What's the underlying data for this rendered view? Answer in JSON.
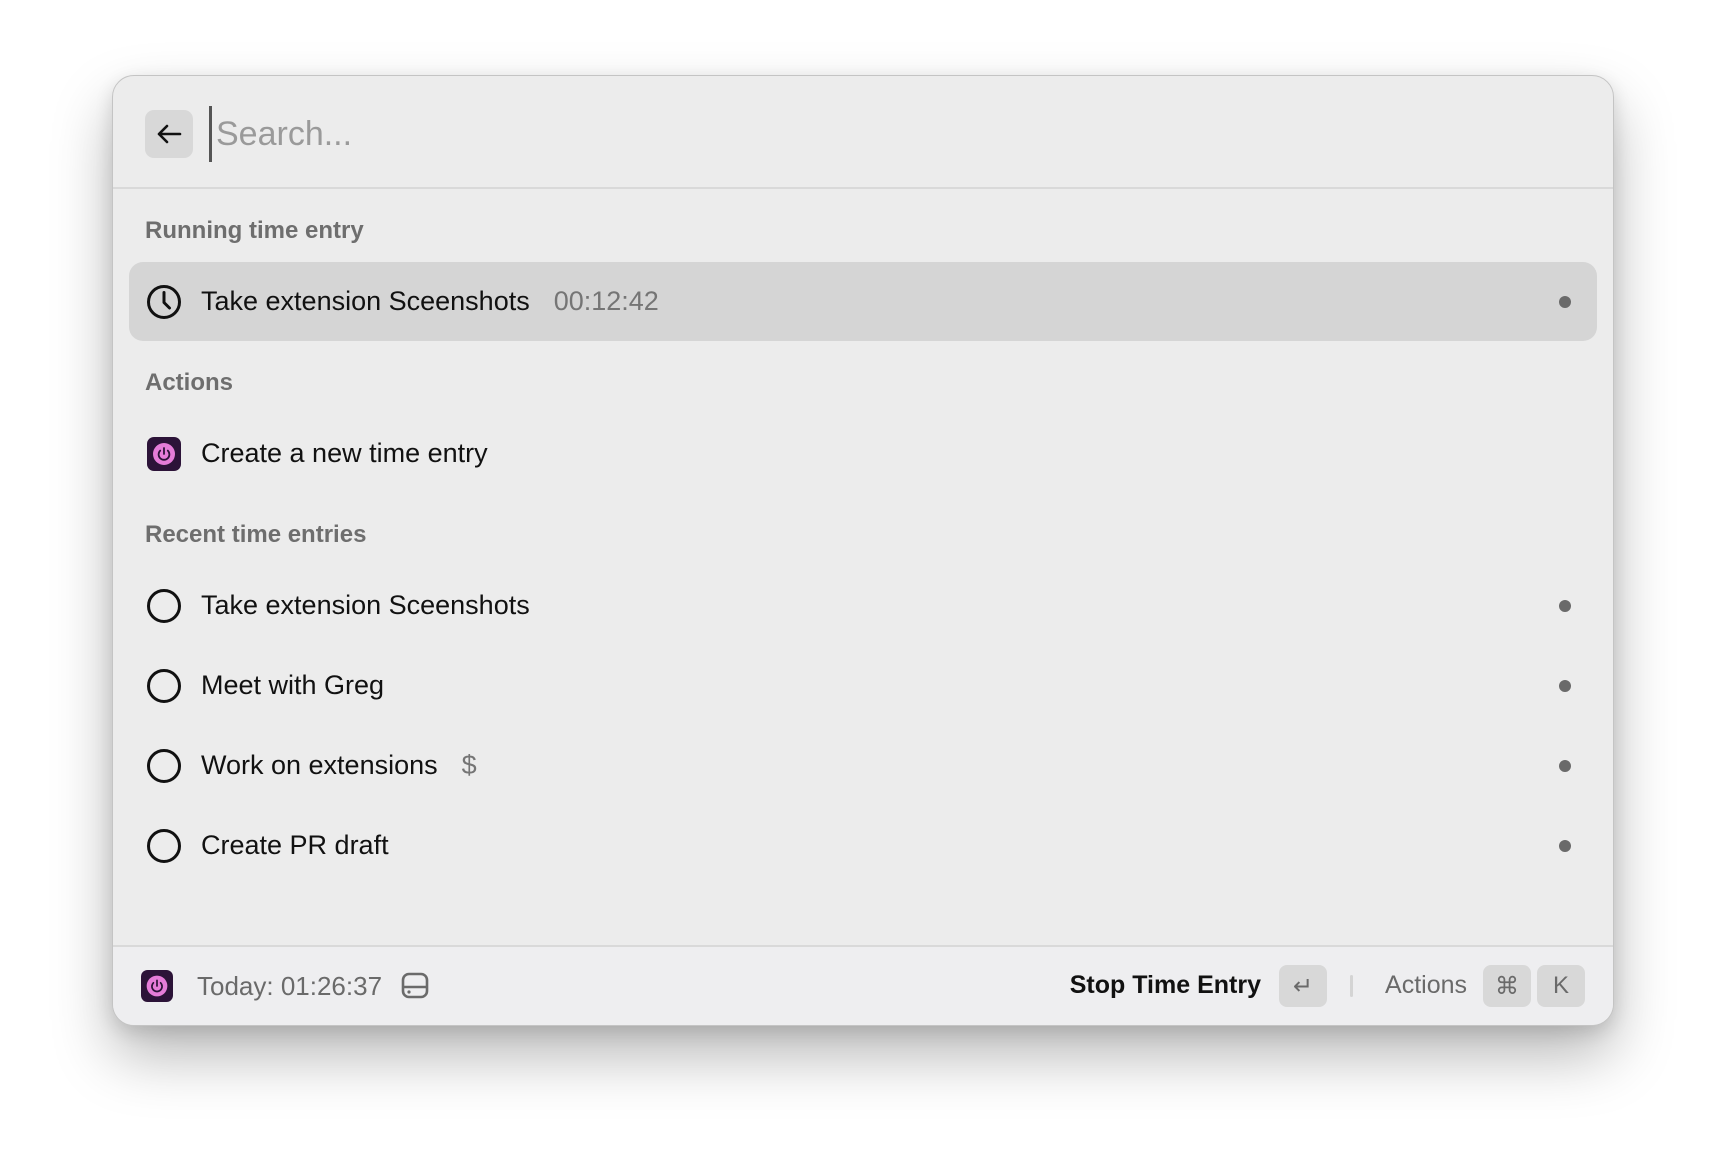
{
  "search": {
    "placeholder": "Search...",
    "value": ""
  },
  "sections": {
    "running": {
      "label": "Running time entry",
      "item": {
        "title": "Take extension Sceenshots",
        "duration": "00:12:42",
        "icon": "clock-icon"
      }
    },
    "actions": {
      "label": "Actions",
      "items": [
        {
          "title": "Create a new time entry",
          "icon": "toggl-app-icon"
        }
      ]
    },
    "recent": {
      "label": "Recent time entries",
      "items": [
        {
          "title": "Take extension Sceenshots",
          "accessory": "",
          "icon": "circle-icon"
        },
        {
          "title": "Meet with Greg",
          "accessory": "",
          "icon": "circle-icon"
        },
        {
          "title": "Work on extensions",
          "accessory": "$",
          "icon": "circle-icon"
        },
        {
          "title": "Create PR draft",
          "accessory": "",
          "icon": "circle-icon"
        }
      ]
    }
  },
  "footer": {
    "today": "Today: 01:26:37",
    "primary_action": "Stop Time Entry",
    "primary_shortcut": "↵",
    "actions_label": "Actions",
    "actions_shortcut": [
      "⌘",
      "K"
    ]
  },
  "colors": {
    "app_icon_bg": "#2c1338",
    "app_icon_fg": "#e57cd8",
    "selected_row": "#d5d5d5",
    "window_bg": "#ececec"
  }
}
